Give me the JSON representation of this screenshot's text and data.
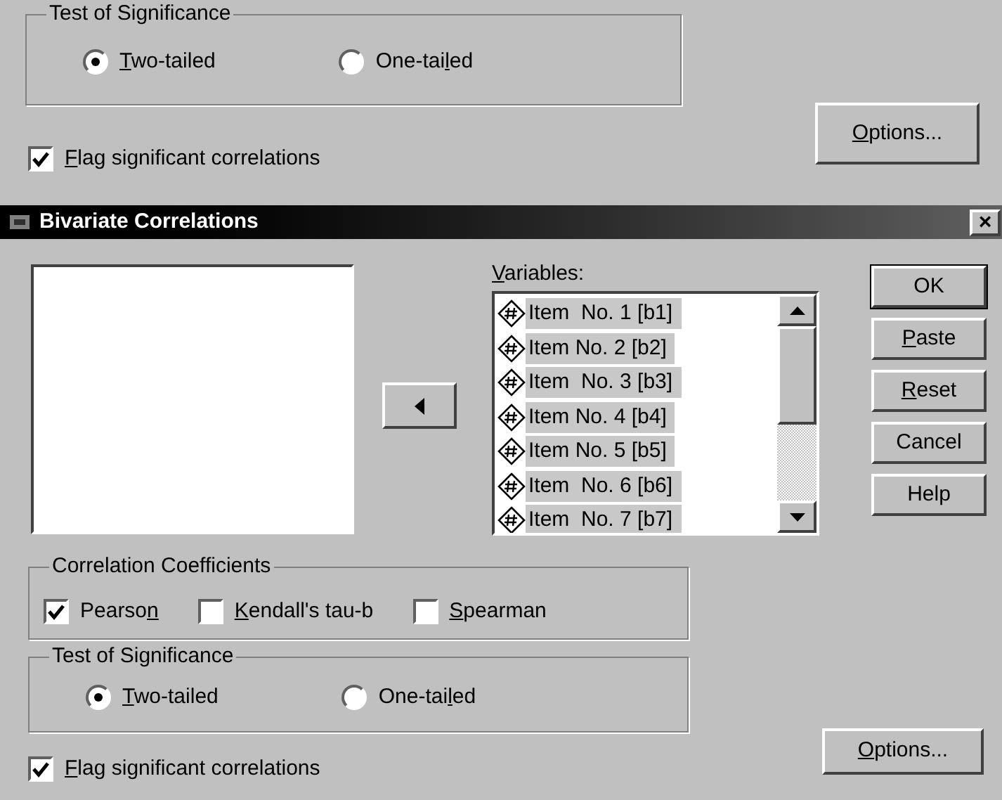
{
  "background_dialog": {
    "significance_group": {
      "title": "Test of Significance",
      "options": [
        {
          "label": {
            "key": "T",
            "post": "wo-tailed"
          },
          "selected": true
        },
        {
          "label": {
            "pre": "One-tai",
            "key": "l",
            "post": "ed"
          },
          "selected": false
        }
      ]
    },
    "flag": {
      "label": {
        "key": "F",
        "post": "lag significant correlations"
      },
      "checked": true
    },
    "options_button": {
      "label": {
        "key": "O",
        "post": "ptions..."
      }
    }
  },
  "window": {
    "title": "Bivariate Correlations",
    "close": "×"
  },
  "variables": {
    "label": {
      "key": "V",
      "post": "ariables:"
    },
    "items": [
      {
        "label": "Item  No. 1 [b1]",
        "selected": true
      },
      {
        "label": "Item No. 2 [b2]",
        "selected": true
      },
      {
        "label": "Item  No. 3 [b3]",
        "selected": true
      },
      {
        "label": "Item No. 4 [b4]",
        "selected": true
      },
      {
        "label": "Item No. 5 [b5]",
        "selected": true
      },
      {
        "label": "Item  No. 6 [b6]",
        "selected": true
      },
      {
        "label": "Item  No. 7 [b7]",
        "selected": true
      }
    ]
  },
  "buttons": [
    {
      "label": {
        "pre": "OK"
      },
      "default": true
    },
    {
      "label": {
        "key": "P",
        "post": "aste"
      },
      "default": false
    },
    {
      "label": {
        "key": "R",
        "post": "eset"
      },
      "default": false
    },
    {
      "label": {
        "pre": "Cancel"
      },
      "default": false
    },
    {
      "label": {
        "pre": "Help"
      },
      "default": false
    }
  ],
  "coefficients_group": {
    "title": "Correlation Coefficients",
    "options": [
      {
        "label": {
          "pre": "Pearso",
          "key": "n"
        },
        "checked": true
      },
      {
        "label": {
          "key": "K",
          "post": "endall's tau-b"
        },
        "checked": false
      },
      {
        "label": {
          "key": "S",
          "post": "pearman"
        },
        "checked": false
      }
    ]
  },
  "significance_group": {
    "title": "Test of Significance",
    "options": [
      {
        "label": {
          "key": "T",
          "post": "wo-tailed"
        },
        "selected": true
      },
      {
        "label": {
          "pre": "One-tai",
          "key": "l",
          "post": "ed"
        },
        "selected": false
      }
    ]
  },
  "flag": {
    "label": {
      "key": "F",
      "post": "lag significant correlations"
    },
    "checked": true
  },
  "options_button": {
    "label": {
      "key": "O",
      "post": "ptions..."
    }
  }
}
